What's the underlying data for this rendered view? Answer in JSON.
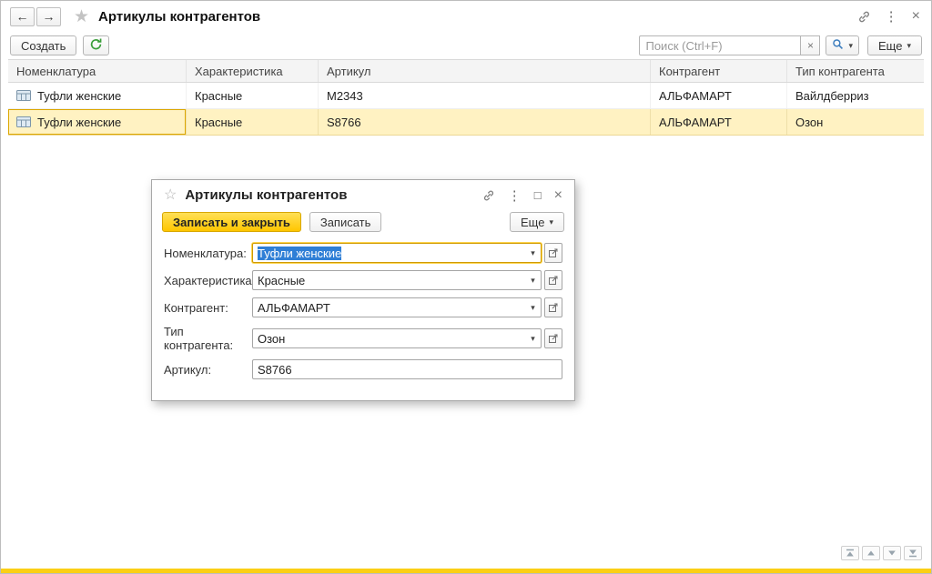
{
  "window": {
    "title": "Артикулы контрагентов"
  },
  "icons": {
    "back": "←",
    "forward": "→",
    "favorite": "★",
    "favorite_outline": "☆",
    "menu_dots": "⋮",
    "close": "×",
    "maximize": "□",
    "clear": "×",
    "caret_down": "▾"
  },
  "toolbar": {
    "create": "Создать",
    "search_placeholder": "Поиск (Ctrl+F)",
    "more": "Еще"
  },
  "table": {
    "columns": [
      "Номенклатура",
      "Характеристика",
      "Артикул",
      "Контрагент",
      "Тип контрагента"
    ],
    "rows": [
      {
        "nomenclature": "Туфли женские",
        "characteristic": "Красные",
        "article": "M2343",
        "counterparty": "АЛЬФАМАРТ",
        "counterparty_type": "Вайлдберриз"
      },
      {
        "nomenclature": "Туфли женские",
        "characteristic": "Красные",
        "article": "S8766",
        "counterparty": "АЛЬФАМАРТ",
        "counterparty_type": "Озон"
      }
    ],
    "selected_row_index": 1
  },
  "dialog": {
    "title": "Артикулы контрагентов",
    "save_and_close": "Записать и закрыть",
    "save": "Записать",
    "more": "Еще",
    "fields": [
      {
        "label": "Номенклатура:",
        "value": "Туфли женские"
      },
      {
        "label": "Характеристика:",
        "value": "Красные"
      },
      {
        "label": "Контрагент:",
        "value": "АЛЬФАМАРТ"
      },
      {
        "label": "Тип контрагента:",
        "value": "Озон"
      },
      {
        "label": "Артикул:",
        "value": "S8766"
      }
    ]
  },
  "colors": {
    "accent_yellow": "#ffc600",
    "selected_row": "#fff2c2",
    "focused_field_border": "#cf9a00"
  }
}
